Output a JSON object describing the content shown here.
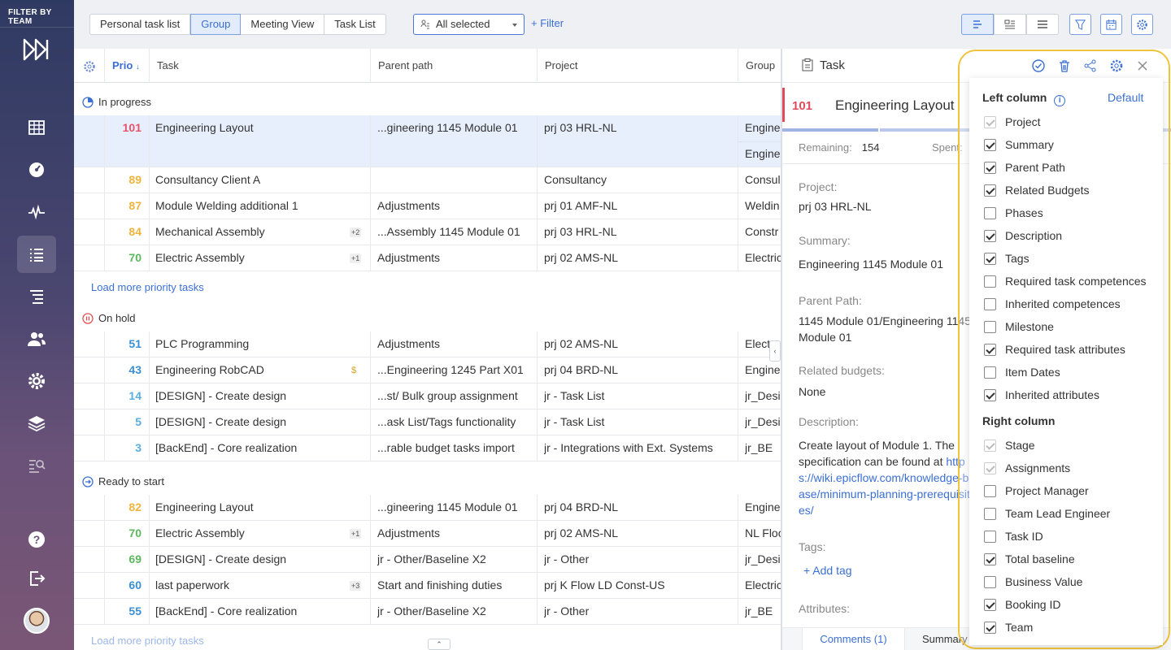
{
  "sidebar": {
    "filter_title": "FILTER BY TEAM",
    "nav": [
      "calendar-grid-icon",
      "dashboard-gauge-icon",
      "pulse-icon",
      "task-list-icon",
      "tree-list-icon",
      "users-icon",
      "settings-gear-icon",
      "layers-icon",
      "analytics-icon",
      "help-icon",
      "logout-icon"
    ]
  },
  "toolbar": {
    "views": [
      "Personal task list",
      "Group",
      "Meeting View",
      "Task List"
    ],
    "active_view": "Group",
    "group_select": "All selected",
    "filter_label": "+ Filter"
  },
  "table": {
    "headers": {
      "prio": "Prio",
      "task": "Task",
      "parent": "Parent path",
      "project": "Project",
      "group": "Group"
    },
    "groups": [
      {
        "title": "In progress",
        "rows": [
          {
            "prio": "101",
            "color": "#e8536a",
            "task": "Engineering Layout",
            "badge": "",
            "parent": "...gineering 1145 Module 01",
            "project": "prj 03 HRL-NL",
            "group": "Engine",
            "group2": "Engine"
          },
          {
            "prio": "89",
            "color": "#f0b43c",
            "task": "Consultancy Client A",
            "badge": "",
            "parent": "",
            "project": "Consultancy",
            "group": "Consul"
          },
          {
            "prio": "87",
            "color": "#f0b43c",
            "task": "Module Welding additional 1",
            "badge": "",
            "parent": "Adjustments",
            "project": "prj 01 AMF-NL",
            "group": "Weldin"
          },
          {
            "prio": "84",
            "color": "#f0b43c",
            "task": "Mechanical Assembly",
            "badge": "+2",
            "parent": "...Assembly 1145 Module 01",
            "project": "prj 03 HRL-NL",
            "group": "Constr"
          },
          {
            "prio": "70",
            "color": "#5cb85c",
            "task": "Electric Assembly",
            "badge": "+1",
            "parent": "Adjustments",
            "project": "prj 02 AMS-NL",
            "group": "Electric"
          }
        ],
        "load_more": "Load more priority tasks"
      },
      {
        "title": "On hold",
        "rows": [
          {
            "prio": "51",
            "color": "#3b8fd4",
            "task": "PLC Programming",
            "badge": "",
            "parent": "Adjustments",
            "project": "prj 02 AMS-NL",
            "group": "Elect"
          },
          {
            "prio": "43",
            "color": "#3b8fd4",
            "task": "Engineering RobCAD",
            "badge": "$",
            "parent": "...Engineering 1245 Part X01",
            "project": "prj 04 BRD-NL",
            "group": "Engine"
          },
          {
            "prio": "14",
            "color": "#5aaee0",
            "task": "[DESIGN] - Create design",
            "badge": "",
            "parent": "...st/ Bulk group assignment",
            "project": "jr - Task List",
            "group": "jr_Desi"
          },
          {
            "prio": "5",
            "color": "#5aaee0",
            "task": "[DESIGN] - Create design",
            "badge": "",
            "parent": "...ask List/Tags functionality",
            "project": "jr - Task List",
            "group": "jr_Desi"
          },
          {
            "prio": "3",
            "color": "#5aaee0",
            "task": "[BackEnd] - Core realization",
            "badge": "",
            "parent": "...rable budget tasks import",
            "project": "jr - Integrations with Ext. Systems",
            "group": "jr_BE"
          }
        ]
      },
      {
        "title": "Ready to start",
        "rows": [
          {
            "prio": "82",
            "color": "#f0b43c",
            "task": "Engineering Layout",
            "badge": "",
            "parent": "...gineering 1145 Module 01",
            "project": "prj 04 BRD-NL",
            "group": "Engine"
          },
          {
            "prio": "70",
            "color": "#5cb85c",
            "task": "Electric Assembly",
            "badge": "+1",
            "parent": "Adjustments",
            "project": "prj 02 AMS-NL",
            "group": "NL Floo"
          },
          {
            "prio": "69",
            "color": "#5cb85c",
            "task": "[DESIGN] - Create design",
            "badge": "",
            "parent": "jr - Other/Baseline X2",
            "project": "jr - Other",
            "group": "jr_Desi"
          },
          {
            "prio": "60",
            "color": "#3b8fd4",
            "task": "last paperwork",
            "badge": "+3",
            "parent": "Start and finishing duties",
            "project": "prj K Flow LD Const-US",
            "group": "Electric"
          },
          {
            "prio": "55",
            "color": "#3b8fd4",
            "task": "[BackEnd] - Core realization",
            "badge": "",
            "parent": "jr - Other/Baseline X2",
            "project": "jr - Other",
            "group": "jr_BE"
          }
        ],
        "load_more": "Load more priority tasks"
      }
    ]
  },
  "detail": {
    "header": "Task",
    "task_num": "101",
    "task_name": "Engineering Layout",
    "remaining_label": "Remaining:",
    "remaining_value": "154",
    "spent_label": "Spent:",
    "project_label": "Project:",
    "project_value": "prj 03 HRL-NL",
    "summary_label": "Summary:",
    "summary_value": "Engineering 1145 Module 01",
    "parent_label": "Parent Path:",
    "parent_value": "1145 Module 01/Engineering 1145 Module 01",
    "budgets_label": "Related budgets:",
    "budgets_value": "None",
    "desc_label": "Description:",
    "desc_text": "Create layout of Module 1. The specification can be found at",
    "desc_link": "https://wiki.epicflow.com/knowledge-base/minimum-planning-prerequisites/",
    "tags_label": "Tags:",
    "add_tag": "+ Add tag",
    "attributes_label": "Attributes:",
    "tabs": [
      "Comments (1)",
      "Summary"
    ]
  },
  "popup": {
    "left_title": "Left column",
    "default_link": "Default",
    "left_items": [
      {
        "label": "Project",
        "state": "disabled"
      },
      {
        "label": "Summary",
        "state": "on"
      },
      {
        "label": "Parent Path",
        "state": "on"
      },
      {
        "label": "Related Budgets",
        "state": "on"
      },
      {
        "label": "Phases",
        "state": "off"
      },
      {
        "label": "Description",
        "state": "on"
      },
      {
        "label": "Tags",
        "state": "on"
      },
      {
        "label": "Required task competences",
        "state": "off"
      },
      {
        "label": "Inherited competences",
        "state": "off"
      },
      {
        "label": "Milestone",
        "state": "off"
      },
      {
        "label": "Required task attributes",
        "state": "on"
      },
      {
        "label": "Item Dates",
        "state": "off"
      },
      {
        "label": "Inherited attributes",
        "state": "on"
      }
    ],
    "right_title": "Right column",
    "right_items": [
      {
        "label": "Stage",
        "state": "disabled"
      },
      {
        "label": "Assignments",
        "state": "disabled"
      },
      {
        "label": "Project Manager",
        "state": "off"
      },
      {
        "label": "Team Lead Engineer",
        "state": "off"
      },
      {
        "label": "Task ID",
        "state": "off"
      },
      {
        "label": "Total baseline",
        "state": "on"
      },
      {
        "label": "Business Value",
        "state": "off"
      },
      {
        "label": "Booking ID",
        "state": "on"
      },
      {
        "label": "Team",
        "state": "on"
      }
    ]
  }
}
